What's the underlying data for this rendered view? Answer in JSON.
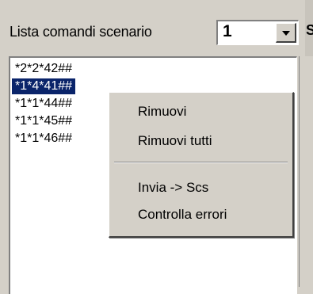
{
  "header": {
    "label": "Lista comandi scenario"
  },
  "combo": {
    "value": "1"
  },
  "right_glyph": "S",
  "list": {
    "items": [
      {
        "text": "*2*2*42##",
        "selected": false
      },
      {
        "text": "*1*4*41##",
        "selected": true
      },
      {
        "text": "*1*1*44##",
        "selected": false
      },
      {
        "text": "*1*1*45##",
        "selected": false
      },
      {
        "text": "*1*1*46##",
        "selected": false
      }
    ]
  },
  "context_menu": {
    "items": [
      "Rimuovi",
      "Rimuovi tutti",
      "Invia -> Scs",
      "Controlla errori"
    ]
  },
  "colors": {
    "selection": "#0a246a",
    "window": "#d4d0c8"
  },
  "icons": {
    "combo_arrow": "chevron-down-icon"
  }
}
